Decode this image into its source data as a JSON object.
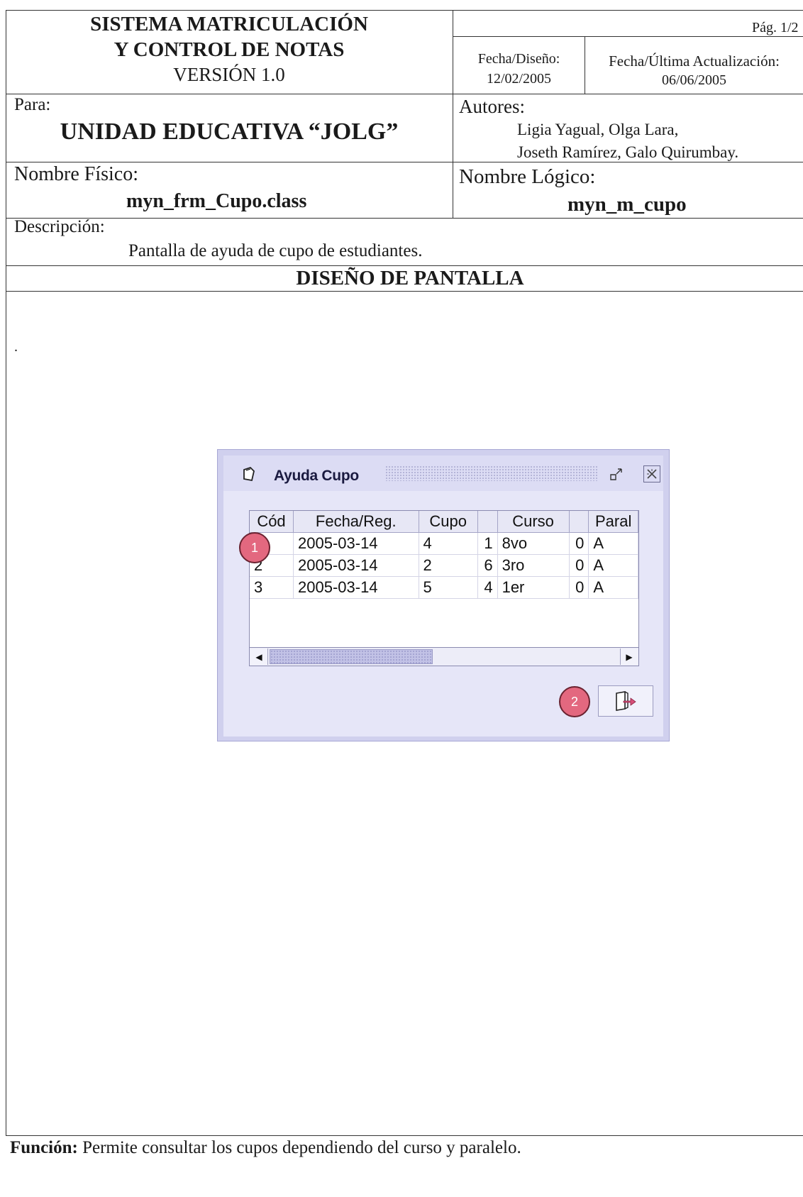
{
  "header": {
    "system_line1": "SISTEMA MATRICULACIÓN",
    "system_line2": "Y CONTROL DE NOTAS",
    "version": "VERSIÓN 1.0",
    "page": "Pág. 1/2",
    "fecha_diseno_label": "Fecha/Diseño:",
    "fecha_diseno_value": "12/02/2005",
    "fecha_actualizacion_label": "Fecha/Última Actualización:",
    "fecha_actualizacion_value": "06/06/2005",
    "para_label": "Para:",
    "para_value": "UNIDAD EDUCATIVA “JOLG”",
    "autores_label": "Autores:",
    "autores_line1": "Ligia Yagual, Olga Lara,",
    "autores_line2": "Joseth Ramírez, Galo Quirumbay.",
    "nombre_fisico_label": "Nombre Físico:",
    "nombre_fisico_value": "myn_frm_Cupo.class",
    "nombre_logico_label": "Nombre Lógico:",
    "nombre_logico_value": "myn_m_cupo",
    "descripcion_label": "Descripción:",
    "descripcion_value": "Pantalla de ayuda de cupo de estudiantes.",
    "section_title": "DISEÑO DE PANTALLA"
  },
  "dialog": {
    "title": "Ayuda Cupo",
    "window_icon": "window-icon",
    "minimize_icon": "minimize-icon",
    "close_icon": "close-icon",
    "columns": [
      "Cód",
      "Fecha/Reg.",
      "Cupo",
      "",
      "Curso",
      "",
      "Paral"
    ],
    "rows": [
      [
        "1",
        "2005-03-14",
        "4",
        "1",
        "8vo",
        "0",
        "A"
      ],
      [
        "2",
        "2005-03-14",
        "2",
        "6",
        "3ro",
        "0",
        "A"
      ],
      [
        "3",
        "2005-03-14",
        "5",
        "4",
        "1er",
        "0",
        "A"
      ]
    ],
    "exit_icon": "exit-door-icon",
    "markers": [
      "1",
      "2"
    ]
  },
  "footer": {
    "funcion_label": "Función:",
    "funcion_value": " Permite consultar los cupos dependiendo del curso y paralelo."
  }
}
